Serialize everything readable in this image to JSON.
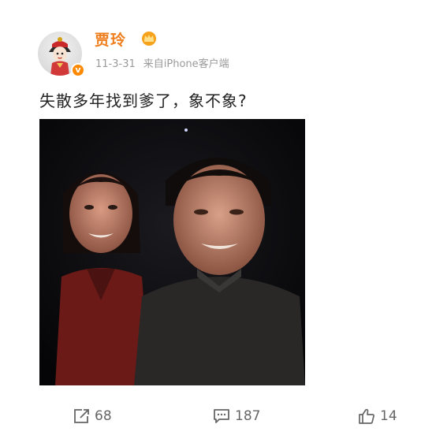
{
  "post": {
    "author": {
      "name": "贾玲",
      "verified_mark": "v",
      "avatar_icon": "avatar-image",
      "crown_icon": "crown-icon"
    },
    "meta": {
      "date": "11-3-31",
      "source": "来自iPhone客户端"
    },
    "text": "失散多年找到爹了，象不象?",
    "photo_icon": "photo-image"
  },
  "actions": {
    "repost": {
      "icon": "repost-icon",
      "count": "68"
    },
    "comment": {
      "icon": "comment-icon",
      "count": "187"
    },
    "like": {
      "icon": "thumbs-up-icon",
      "count": "14"
    }
  },
  "colors": {
    "username": "#ef7d1b",
    "verified_badge": "#ff8a00",
    "meta_text": "#9a9a9a",
    "action_text": "#666666"
  }
}
